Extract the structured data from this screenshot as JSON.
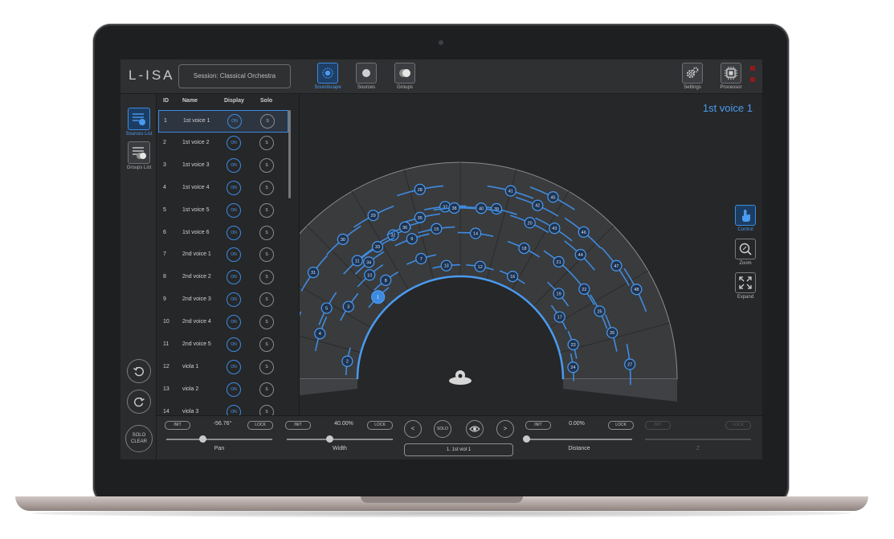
{
  "app": {
    "logo": "L-ISA",
    "session": "Session: Classical Orchestra",
    "colors": {
      "accent": "#4a9bef",
      "panel": "#262729",
      "stage_fill": "#3a3b3d",
      "led": "#8e1b1b"
    }
  },
  "toolbar": {
    "items": [
      {
        "label": "Soundscape",
        "icon": "soundscape-icon",
        "active": true
      },
      {
        "label": "Sources",
        "icon": "sources-icon",
        "active": false
      },
      {
        "label": "Groups",
        "icon": "groups-icon",
        "active": false
      }
    ],
    "right": [
      {
        "label": "Settings",
        "icon": "gear-icon"
      },
      {
        "label": "Processor",
        "icon": "chip-icon"
      }
    ]
  },
  "rail": {
    "sources_list": "Sources List",
    "groups_list": "Groups List",
    "undo_icon": "undo-icon",
    "redo_icon": "redo-icon",
    "solo_clear_1": "SOLO",
    "solo_clear_2": "CLEAR"
  },
  "sources_table": {
    "headers": {
      "id": "ID",
      "name": "Name",
      "display": "Display",
      "solo": "Solo"
    },
    "rows": [
      {
        "id": "1",
        "name": "1st voice  1",
        "display": "ON",
        "solo": "S",
        "selected": true
      },
      {
        "id": "2",
        "name": "1st voice  2",
        "display": "ON",
        "solo": "S"
      },
      {
        "id": "3",
        "name": "1st voice  3",
        "display": "ON",
        "solo": "S"
      },
      {
        "id": "4",
        "name": "1st voice  4",
        "display": "ON",
        "solo": "S"
      },
      {
        "id": "5",
        "name": "1st voice  5",
        "display": "ON",
        "solo": "S"
      },
      {
        "id": "6",
        "name": "1st voice  6",
        "display": "ON",
        "solo": "S"
      },
      {
        "id": "7",
        "name": "2nd voice  1",
        "display": "ON",
        "solo": "S"
      },
      {
        "id": "8",
        "name": "2nd voice  2",
        "display": "ON",
        "solo": "S"
      },
      {
        "id": "9",
        "name": "2nd voice  3",
        "display": "ON",
        "solo": "S"
      },
      {
        "id": "10",
        "name": "2nd voice  4",
        "display": "ON",
        "solo": "S"
      },
      {
        "id": "11",
        "name": "2nd voice  5",
        "display": "ON",
        "solo": "S"
      },
      {
        "id": "12",
        "name": "viola 1",
        "display": "ON",
        "solo": "S"
      },
      {
        "id": "13",
        "name": "viola 2",
        "display": "ON",
        "solo": "S"
      },
      {
        "id": "14",
        "name": "viola 3",
        "display": "ON",
        "solo": "S"
      }
    ]
  },
  "main": {
    "selected_title": "1st voice 1",
    "sources": [
      {
        "n": "1",
        "angle": 135,
        "dist": 0.04,
        "selected": true
      },
      {
        "n": "2",
        "angle": 171,
        "dist": 0.02
      },
      {
        "n": "3",
        "angle": 147,
        "dist": 0.22
      },
      {
        "n": "4",
        "angle": 162,
        "dist": 0.37
      },
      {
        "n": "5",
        "angle": 152,
        "dist": 0.41
      },
      {
        "n": "6",
        "angle": 164,
        "dist": 0.64
      },
      {
        "n": "7",
        "angle": 108,
        "dist": 0.15
      },
      {
        "n": "8",
        "angle": 127,
        "dist": 0.12
      },
      {
        "n": "9",
        "angle": 109,
        "dist": 0.38
      },
      {
        "n": "10",
        "angle": 131,
        "dist": 0.27
      },
      {
        "n": "11",
        "angle": 131,
        "dist": 0.47
      },
      {
        "n": "12",
        "angle": 80,
        "dist": 0.02
      },
      {
        "n": "13",
        "angle": 97,
        "dist": 0.02
      },
      {
        "n": "14",
        "angle": 84,
        "dist": 0.36
      },
      {
        "n": "15",
        "angle": 99,
        "dist": 0.42
      },
      {
        "n": "16",
        "angle": 63,
        "dist": 0.03
      },
      {
        "n": "17",
        "angle": 32,
        "dist": 0.05
      },
      {
        "n": "18",
        "angle": 64,
        "dist": 0.35
      },
      {
        "n": "19",
        "angle": 41,
        "dist": 0.19
      },
      {
        "n": "20",
        "angle": 66,
        "dist": 0.62
      },
      {
        "n": "21",
        "angle": 50,
        "dist": 0.43
      },
      {
        "n": "22",
        "angle": 36,
        "dist": 0.43
      },
      {
        "n": "23",
        "angle": 17,
        "dist": 0.06
      },
      {
        "n": "24",
        "angle": 6,
        "dist": 0.01
      },
      {
        "n": "25",
        "angle": 26,
        "dist": 0.45
      },
      {
        "n": "26",
        "angle": 17,
        "dist": 0.49
      },
      {
        "n": "27",
        "angle": 5,
        "dist": 0.61
      },
      {
        "n": "28",
        "angle": 102,
        "dist": 0.86
      },
      {
        "n": "29",
        "angle": 118,
        "dist": 0.77
      },
      {
        "n": "30",
        "angle": 130,
        "dist": 0.74
      },
      {
        "n": "31",
        "angle": 144,
        "dist": 0.73
      },
      {
        "n": "32",
        "angle": 115,
        "dist": 0.49
      },
      {
        "n": "33",
        "angle": 122,
        "dist": 0.46
      },
      {
        "n": "34",
        "angle": 128,
        "dist": 0.38
      },
      {
        "n": "35",
        "angle": 104,
        "dist": 0.57
      },
      {
        "n": "36",
        "angle": 110,
        "dist": 0.52
      },
      {
        "n": "37",
        "angle": 95,
        "dist": 0.64
      },
      {
        "n": "38",
        "angle": 92,
        "dist": 0.62
      },
      {
        "n": "39",
        "angle": 78,
        "dist": 0.65
      },
      {
        "n": "40",
        "angle": 83,
        "dist": 0.63
      },
      {
        "n": "41",
        "angle": 75,
        "dist": 0.87
      },
      {
        "n": "42",
        "angle": 66,
        "dist": 0.82
      },
      {
        "n": "43",
        "angle": 58,
        "dist": 0.69
      },
      {
        "n": "44",
        "angle": 46,
        "dist": 0.64
      },
      {
        "n": "45",
        "angle": 63,
        "dist": 0.97
      },
      {
        "n": "46",
        "angle": 50,
        "dist": 0.84
      },
      {
        "n": "47",
        "angle": 36,
        "dist": 0.85
      },
      {
        "n": "48",
        "angle": 27,
        "dist": 0.9
      }
    ],
    "tools": [
      {
        "label": "Control",
        "icon": "touch-icon",
        "active": true
      },
      {
        "label": "Zoom",
        "icon": "zoom-icon",
        "active": false
      },
      {
        "label": "Expand",
        "icon": "expand-icon",
        "active": false
      }
    ],
    "listener_icon": "listener-icon"
  },
  "bottom": {
    "init": "INIT",
    "lock": "LOCK",
    "pan": {
      "value": "-56.76°",
      "label": "Pan",
      "level": 0.34
    },
    "width": {
      "value": "40.00%",
      "label": "Width",
      "level": 0.4
    },
    "distance": {
      "value": "0.00%",
      "label": "Distance",
      "level": 0.0
    },
    "z": {
      "value": "",
      "label": "Z"
    },
    "prev": "<",
    "next": ">",
    "solo": "SOLO",
    "eye_icon": "eye-icon",
    "current_source": "1. 1st viol 1"
  }
}
